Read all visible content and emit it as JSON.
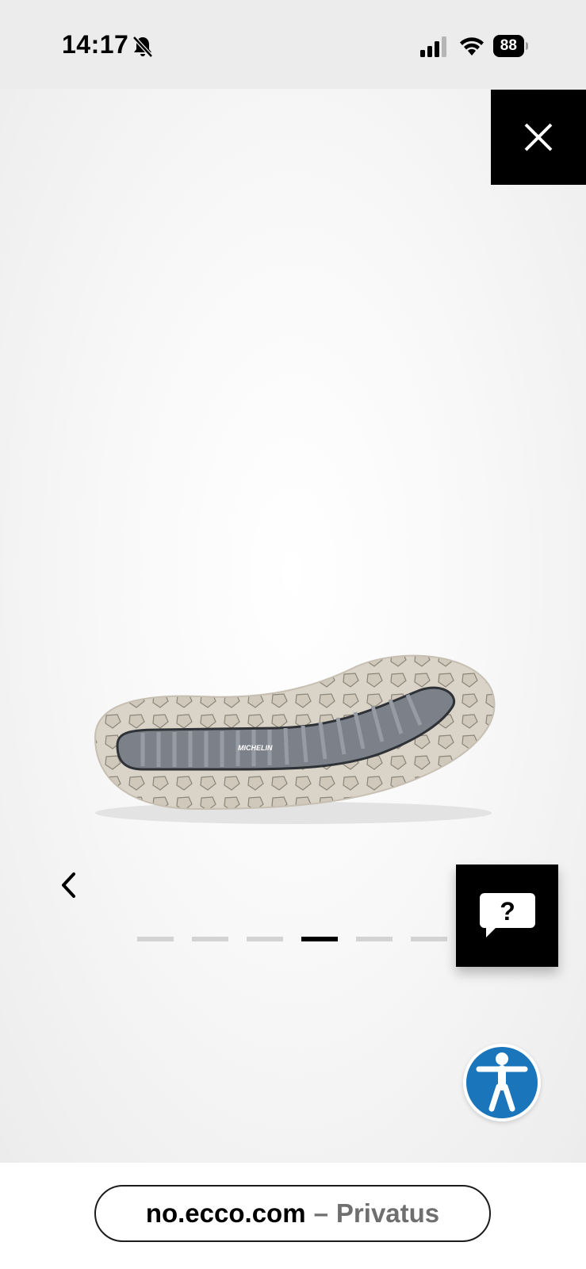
{
  "status_bar": {
    "time": "14:17",
    "battery": "88",
    "icons": [
      "bell-slash-icon",
      "cellular-signal-icon",
      "wifi-icon",
      "battery-icon"
    ]
  },
  "viewer": {
    "close_icon": "close-icon",
    "prev_icon": "chevron-left-icon",
    "product_image": "shoe-outsole-image",
    "sole_brand": "MICHELIN",
    "pager": {
      "total": 6,
      "active_index": 3
    },
    "help_icon": "chat-question-icon",
    "help_glyph": "?",
    "accessibility_icon": "accessibility-icon"
  },
  "browser": {
    "domain": "no.ecco.com",
    "separator": "–",
    "title": "Privatus"
  },
  "colors": {
    "accessibility_blue": "#1a75bb",
    "pager_active": "#000000",
    "pager_inactive": "#d3d3d3"
  }
}
